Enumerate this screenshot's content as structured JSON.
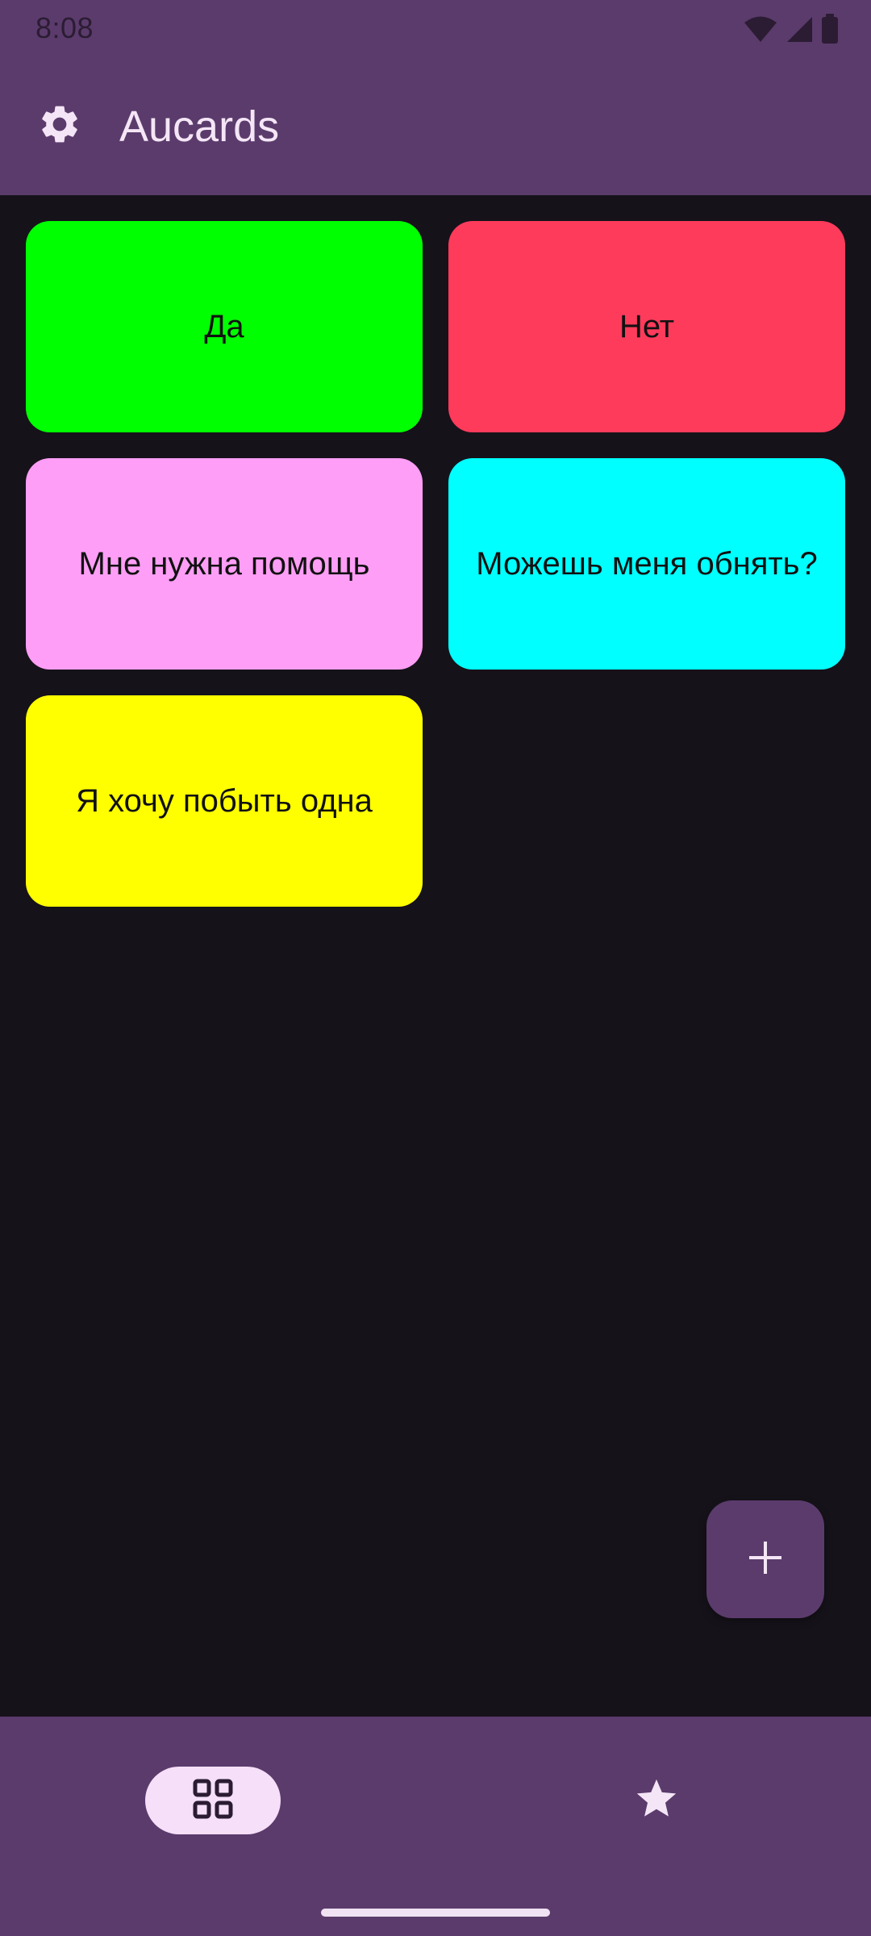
{
  "status_bar": {
    "time": "8:08",
    "icons": [
      "wifi-icon",
      "cell-signal-icon",
      "battery-icon"
    ]
  },
  "app_bar": {
    "title": "Aucards",
    "settings_icon": "gear-icon"
  },
  "cards": [
    {
      "label": "Да",
      "color": "#00ff00"
    },
    {
      "label": "Нет",
      "color": "#ff3b5c"
    },
    {
      "label": "Мне нужна помощь",
      "color": "#ff9ef6"
    },
    {
      "label": "Можешь меня обнять?",
      "color": "#00ffff"
    },
    {
      "label": "Я хочу побыть одна",
      "color": "#ffff00"
    }
  ],
  "fab": {
    "icon": "plus-icon"
  },
  "bottom_nav": {
    "items": [
      {
        "icon": "grid-icon",
        "selected": true
      },
      {
        "icon": "star-icon",
        "selected": false
      }
    ]
  },
  "colors": {
    "surface": "#5b3b6c",
    "background": "#16121a",
    "on_surface": "#f4e6f6",
    "nav_indicator": "#f6dff8"
  }
}
